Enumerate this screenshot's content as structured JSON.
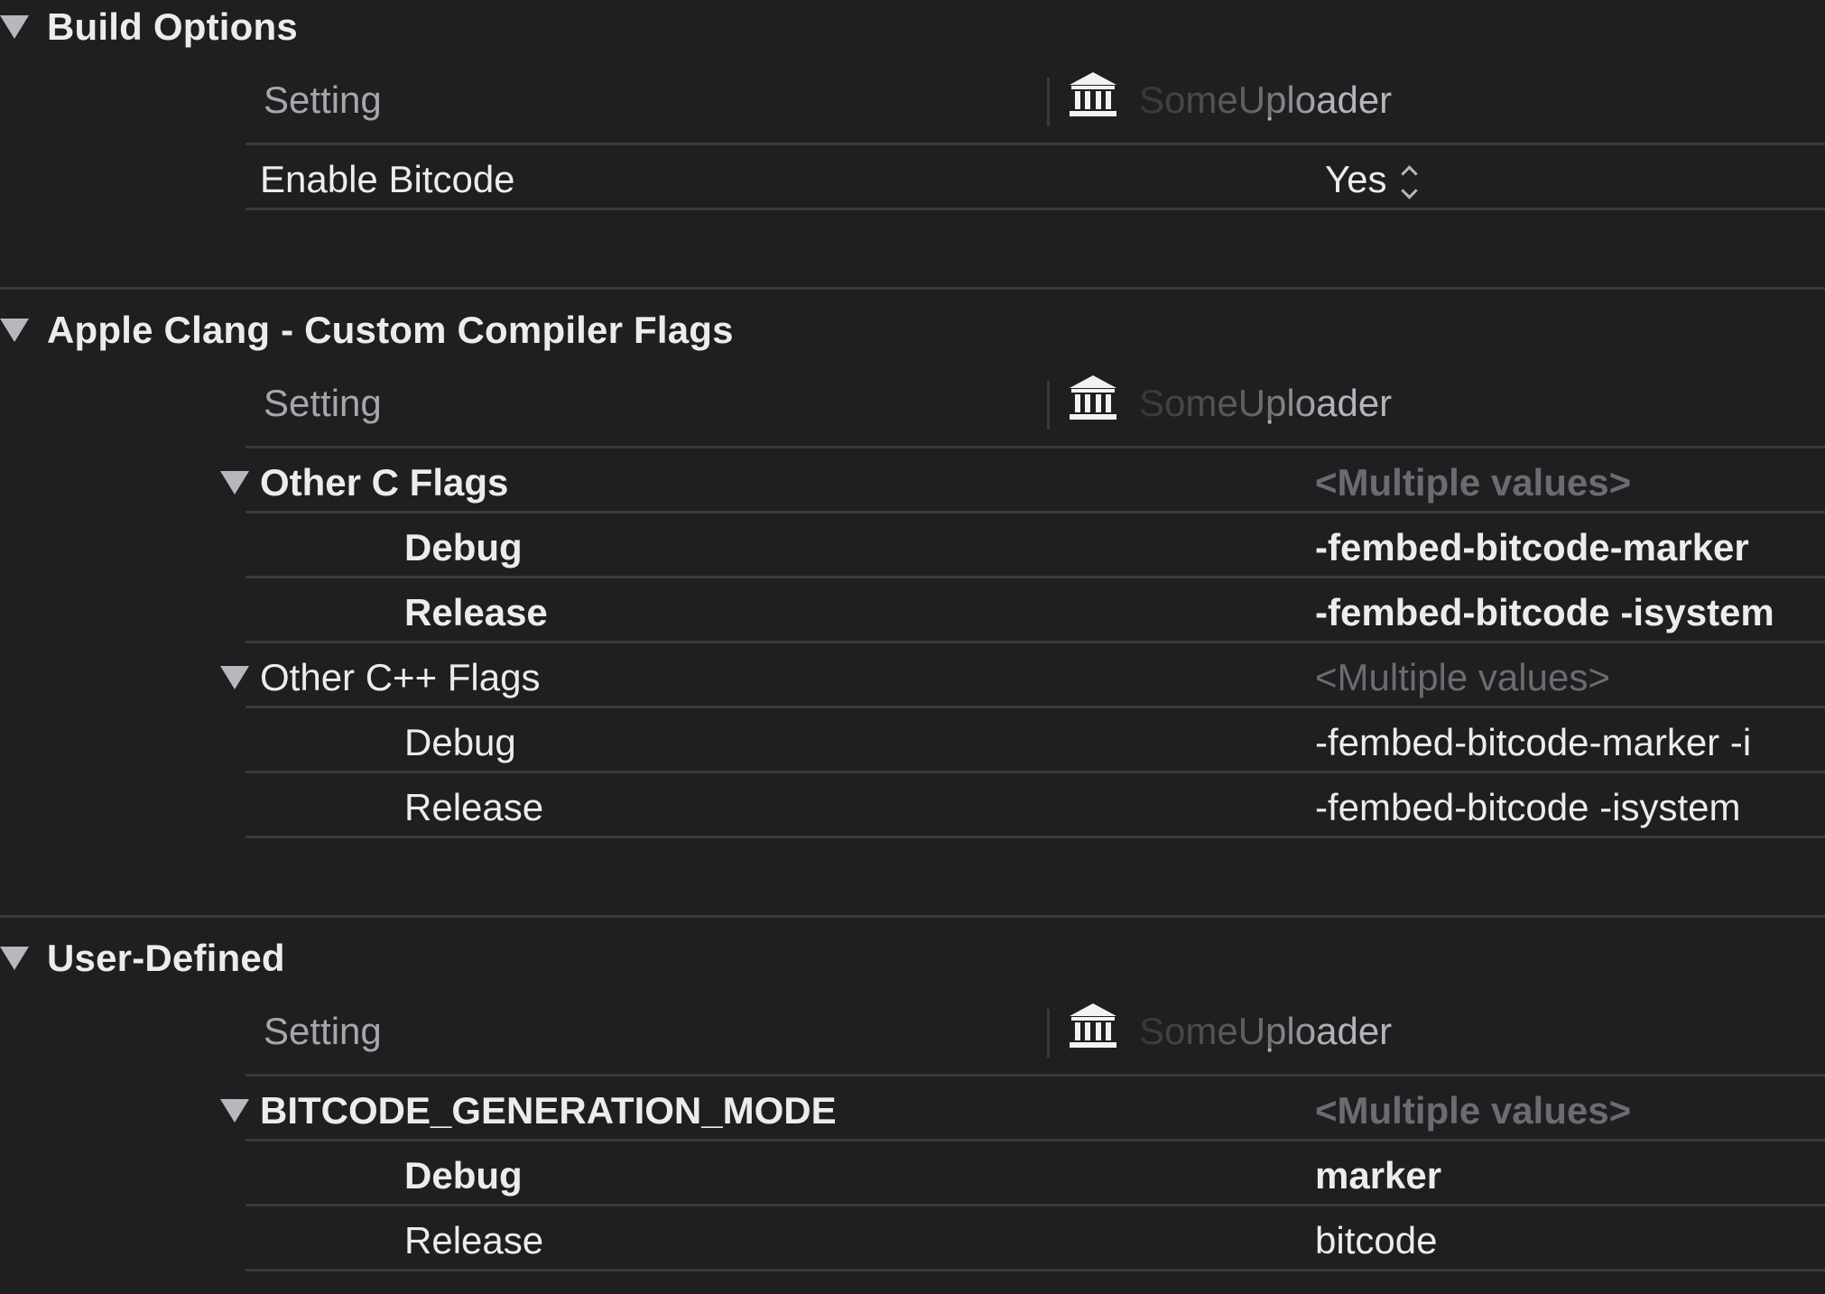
{
  "sections": {
    "build_options": {
      "title": "Build Options",
      "header": {
        "setting_label": "Setting",
        "target_name": "SomeUploader"
      },
      "rows": [
        {
          "name": "Enable Bitcode",
          "value": "Yes"
        }
      ]
    },
    "clang_flags": {
      "title": "Apple Clang - Custom Compiler Flags",
      "header": {
        "setting_label": "Setting",
        "target_name": "SomeUploader"
      },
      "other_c_flags": {
        "name": "Other C Flags",
        "value": "<Multiple values>",
        "debug": {
          "name": "Debug",
          "value": "-fembed-bitcode-marker"
        },
        "release": {
          "name": "Release",
          "value": "-fembed-bitcode -isystem"
        }
      },
      "other_cpp_flags": {
        "name": "Other C++ Flags",
        "value": "<Multiple values>",
        "debug": {
          "name": "Debug",
          "value": "-fembed-bitcode-marker -i"
        },
        "release": {
          "name": "Release",
          "value": "-fembed-bitcode -isystem"
        }
      }
    },
    "user_defined": {
      "title": "User-Defined",
      "header": {
        "setting_label": "Setting",
        "target_name": "SomeUploader"
      },
      "bitcode_mode": {
        "name": "BITCODE_GENERATION_MODE",
        "value": "<Multiple values>",
        "debug": {
          "name": "Debug",
          "value": "marker"
        },
        "release": {
          "name": "Release",
          "value": "bitcode"
        }
      }
    }
  },
  "icons": {
    "disclosure": "disclosure-triangle-icon",
    "target": "building-columns-icon",
    "stepper": "up-down-stepper-icon"
  }
}
